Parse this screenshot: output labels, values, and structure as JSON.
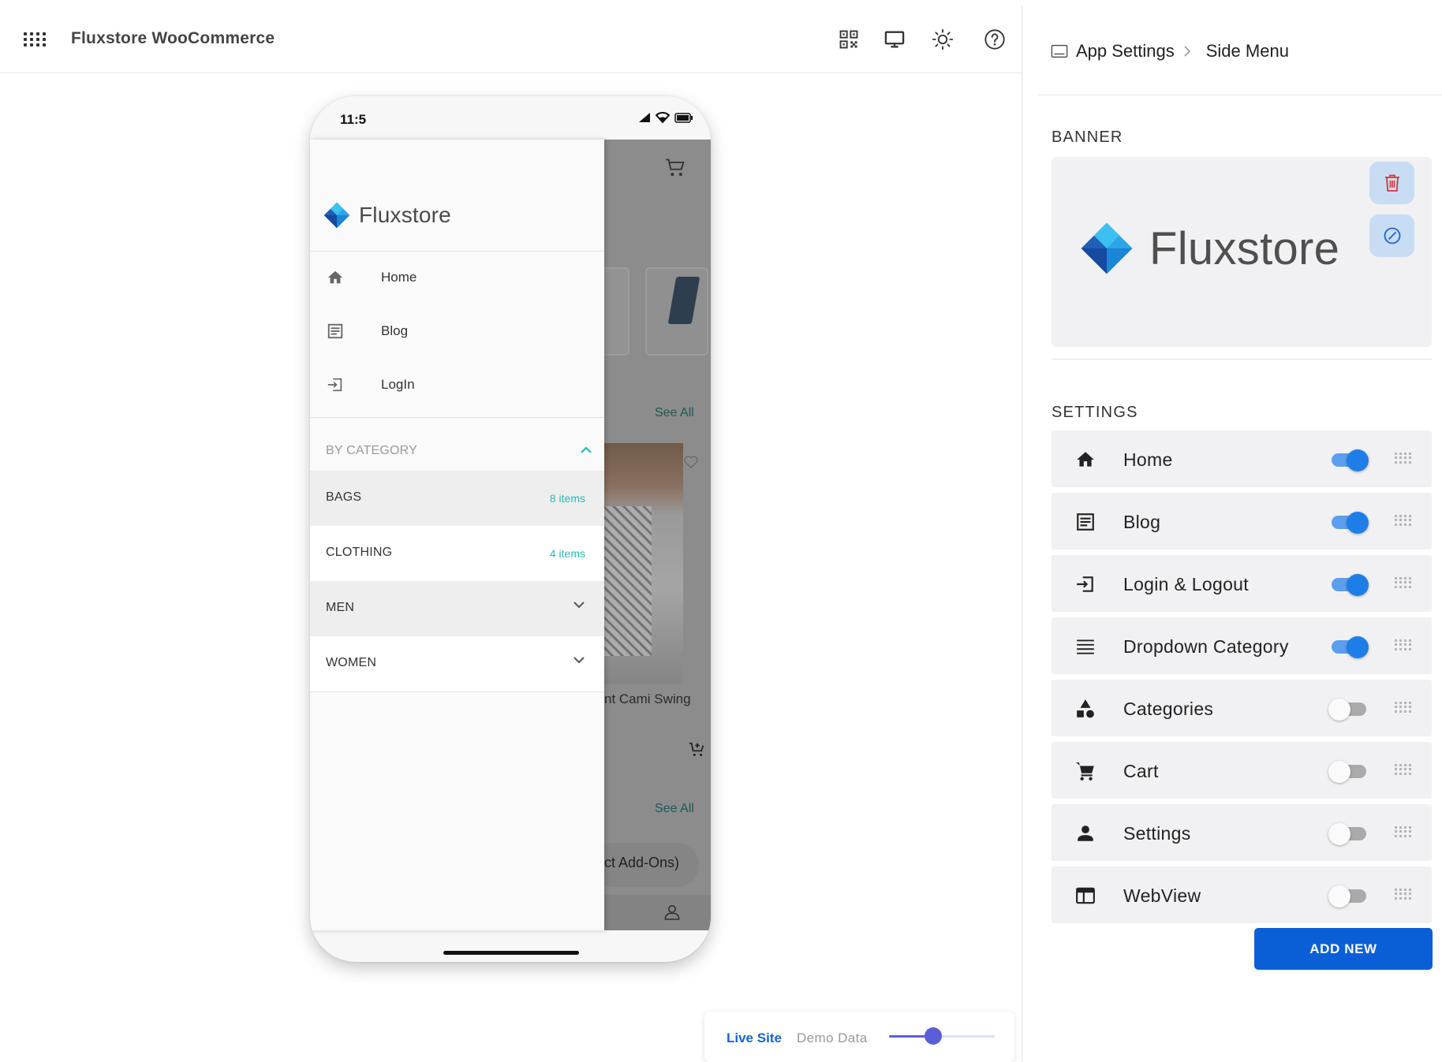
{
  "header": {
    "title": "Fluxstore WooCommerce"
  },
  "phone": {
    "status_time": "11:5",
    "drawer": {
      "logo_text": "Fluxstore",
      "items": [
        {
          "label": "Home",
          "icon": "home-icon"
        },
        {
          "label": "Blog",
          "icon": "article-icon"
        },
        {
          "label": "LogIn",
          "icon": "login-icon"
        }
      ],
      "category_header": "BY CATEGORY",
      "categories": [
        {
          "name": "BAGS",
          "count": "8 items"
        },
        {
          "name": "CLOTHING",
          "count": "4 items"
        },
        {
          "name": "MEN"
        },
        {
          "name": "WOMEN"
        }
      ]
    },
    "background": {
      "see_all_1": "See All",
      "see_all_2": "See All",
      "product_name": "nt Cami Swing",
      "pill_text": "ct Add-Ons)"
    }
  },
  "data_source": {
    "live_label": "Live Site",
    "demo_label": "Demo Data",
    "slider_value": 0.42
  },
  "panel": {
    "breadcrumb": {
      "root": "App Settings",
      "current": "Side Menu"
    },
    "banner_title": "BANNER",
    "banner_logo_text": "Fluxstore",
    "settings_title": "SETTINGS",
    "items": [
      {
        "label": "Home",
        "icon": "home-icon",
        "enabled": true
      },
      {
        "label": "Blog",
        "icon": "article-icon",
        "enabled": true
      },
      {
        "label": "Login & Logout",
        "icon": "login-icon",
        "enabled": true
      },
      {
        "label": "Dropdown Category",
        "icon": "list-icon",
        "enabled": true
      },
      {
        "label": "Categories",
        "icon": "category-shapes-icon",
        "enabled": false
      },
      {
        "label": "Cart",
        "icon": "cart-icon",
        "enabled": false
      },
      {
        "label": "Settings",
        "icon": "person-icon",
        "enabled": false
      },
      {
        "label": "WebView",
        "icon": "webview-icon",
        "enabled": false
      }
    ],
    "add_new_label": "ADD NEW"
  },
  "colors": {
    "accent": "#0a5fd6",
    "toggle_on": "#1e7ee8",
    "teal": "#2bb8b4"
  }
}
